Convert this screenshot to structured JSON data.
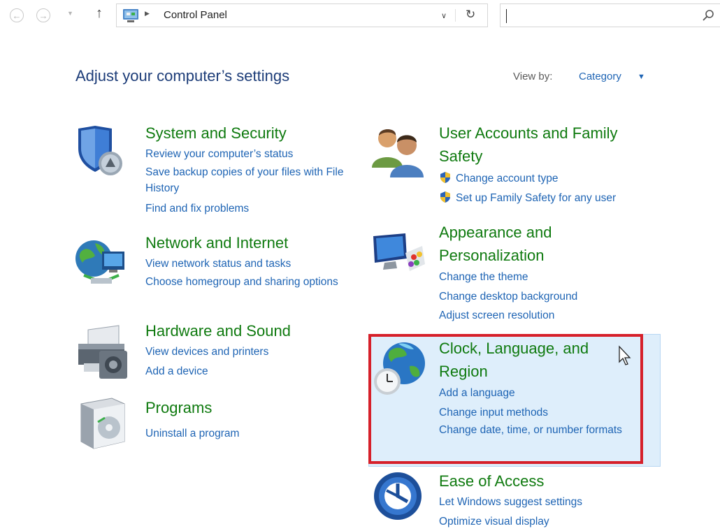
{
  "address_bar": {
    "path_item": "Control Panel"
  },
  "search": {
    "placeholder": ""
  },
  "header": {
    "title": "Adjust your computer’s settings",
    "view_by_label": "View by:",
    "view_by_value": "Category"
  },
  "categories": {
    "system_security": {
      "title": "System and Security",
      "links": [
        "Review your computer’s status",
        "Save backup copies of your files with File History",
        "Find and fix problems"
      ]
    },
    "network": {
      "title": "Network and Internet",
      "links": [
        "View network status and tasks",
        "Choose homegroup and sharing options"
      ]
    },
    "hardware": {
      "title": "Hardware and Sound",
      "links": [
        "View devices and printers",
        "Add a device"
      ]
    },
    "programs": {
      "title": "Programs",
      "links": [
        "Uninstall a program"
      ]
    },
    "user_accounts": {
      "title": "User Accounts and Family Safety",
      "links": [
        "Change account type",
        "Set up Family Safety for any user"
      ]
    },
    "appearance": {
      "title": "Appearance and Personalization",
      "links": [
        "Change the theme",
        "Change desktop background",
        "Adjust screen resolution"
      ]
    },
    "clock": {
      "title": "Clock, Language, and Region",
      "links": [
        "Add a language",
        "Change input methods",
        "Change date, time, or number formats"
      ]
    },
    "ease": {
      "title": "Ease of Access",
      "links": [
        "Let Windows suggest settings",
        "Optimize visual display"
      ]
    }
  },
  "colors": {
    "category_title": "#0f7a0f",
    "link": "#1e64b4",
    "heading": "#1c3c78",
    "highlight_border": "#d6202a",
    "hover_background": "#deeefb"
  },
  "icons": [
    "back-icon",
    "forward-icon",
    "up-icon",
    "control-panel-icon",
    "refresh-icon",
    "search-icon",
    "shield-icon",
    "network-icon",
    "printer-icon",
    "programs-icon",
    "users-icon",
    "appearance-icon",
    "globe-clock-icon",
    "ease-of-access-icon",
    "uac-shield-icon",
    "mouse-cursor-icon"
  ]
}
